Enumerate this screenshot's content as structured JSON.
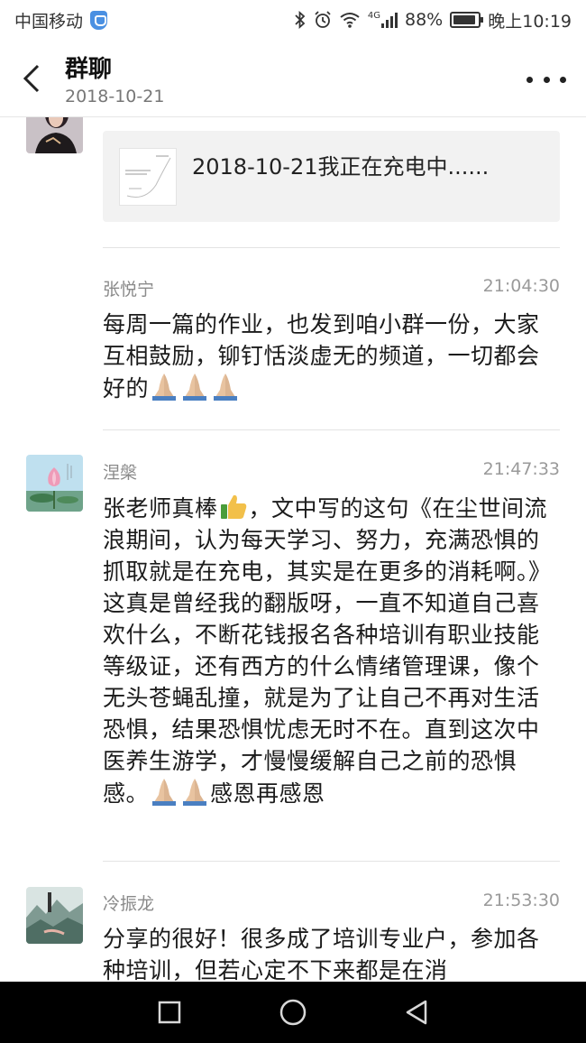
{
  "status_bar": {
    "carrier": "中国移动",
    "network": "4G",
    "battery": "88%",
    "time": "晚上10:19"
  },
  "header": {
    "title": "群聊",
    "subtitle": "2018-10-21"
  },
  "messages": [
    {
      "share_text": "2018-10-21我正在充电中......"
    },
    {
      "name": "张悦宁",
      "time": "21:04:30",
      "text": "每周一篇的作业，也发到咱小群一份，大家互相鼓励，铆钉恬淡虚无的频道，一切都会好的"
    },
    {
      "name": "涅槃",
      "time": "21:47:33",
      "text_a": "张老师真棒",
      "text_b": "，文中写的这句《在尘世间流浪期间，认为每天学习、努力，充满恐惧的抓取就是在充电，其实是在更多的消耗啊。》这真是曾经我的翻版呀，一直不知道自己喜欢什么，不断花钱报名各种培训有职业技能等级证，还有西方的什么情绪管理课，像个无头苍蝇乱撞，就是为了让自己不再对生活恐惧，结果恐惧忧虑无时不在。直到这次中医养生游学，才慢慢缓解自己之前的恐惧感。",
      "text_c": "感恩再感恩"
    },
    {
      "name": "冷振龙",
      "time": "21:53:30",
      "text": "分享的很好！很多成了培训专业户，参加各种培训，但若心定不下来都是在消"
    }
  ]
}
